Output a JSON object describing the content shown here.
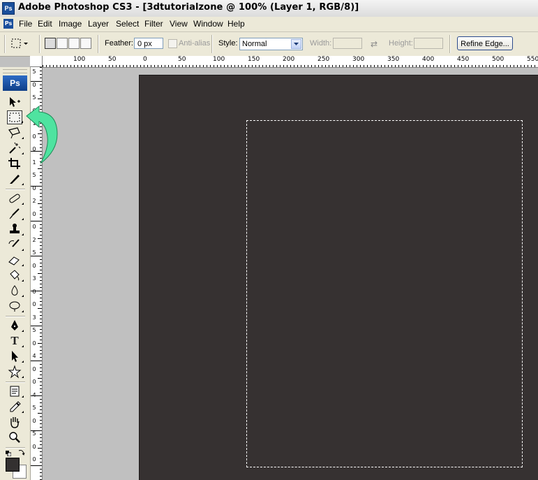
{
  "window": {
    "app_icon": "Ps",
    "title": "Adobe Photoshop CS3 - [3dtutorialzone @ 100% (Layer 1, RGB/8)]"
  },
  "menubar": {
    "doc_icon": "Ps",
    "items": [
      "File",
      "Edit",
      "Image",
      "Layer",
      "Select",
      "Filter",
      "View",
      "Window",
      "Help"
    ]
  },
  "options": {
    "feather_label": "Feather:",
    "feather_value": "0 px",
    "antialias_label": "Anti-alias",
    "style_label": "Style:",
    "style_value": "Normal",
    "width_label": "Width:",
    "height_label": "Height:",
    "refine_label": "Refine Edge..."
  },
  "toolbox": {
    "logo": "Ps",
    "selected_tool": "rectangular-marquee"
  },
  "ruler": {
    "top_labels": [
      "100",
      "50",
      "0",
      "50",
      "100",
      "150",
      "200",
      "250",
      "300",
      "350",
      "400",
      "450",
      "500",
      "550"
    ],
    "left_labels": [
      "5",
      "0",
      "5",
      "0",
      "1",
      "0",
      "0",
      "1",
      "5",
      "0",
      "2",
      "0",
      "0",
      "2",
      "5",
      "0",
      "3",
      "0",
      "0",
      "3",
      "5",
      "0",
      "4",
      "0",
      "0",
      "4",
      "5",
      "0",
      "5",
      "0",
      "0"
    ]
  },
  "colors": {
    "canvas": "#363131",
    "workspace": "#c0c0c0",
    "arrow": "#4fe3a0",
    "foreground": "#333030",
    "background": "#ffffff"
  }
}
